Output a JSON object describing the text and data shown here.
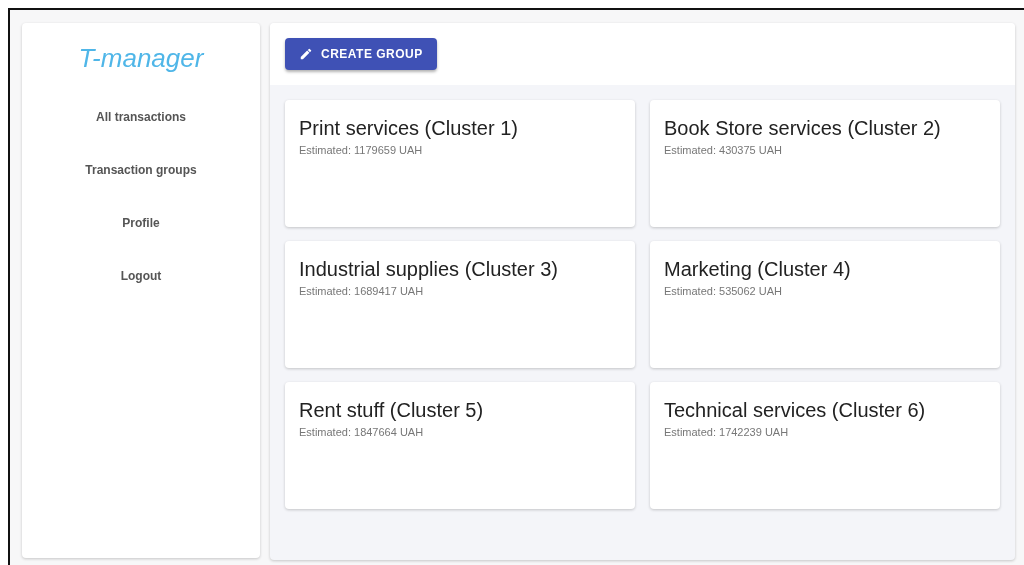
{
  "sidebar": {
    "logo": "T-manager",
    "items": [
      "All transactions",
      "Transaction groups",
      "Profile",
      "Logout"
    ]
  },
  "toolbar": {
    "button": "CREATE GROUP"
  },
  "groups": [
    {
      "title": "Print services (Cluster 1)",
      "estimate": "Estimated: 1179659 UAH"
    },
    {
      "title": "Book Store services (Cluster 2)",
      "estimate": "Estimated: 430375 UAH"
    },
    {
      "title": "Industrial supplies (Cluster 3)",
      "estimate": "Estimated: 1689417 UAH"
    },
    {
      "title": "Marketing (Cluster 4)",
      "estimate": "Estimated: 535062 UAH"
    },
    {
      "title": "Rent stuff (Cluster 5)",
      "estimate": "Estimated: 1847664 UAH"
    },
    {
      "title": "Technical services (Cluster 6)",
      "estimate": "Estimated: 1742239 UAH"
    }
  ]
}
